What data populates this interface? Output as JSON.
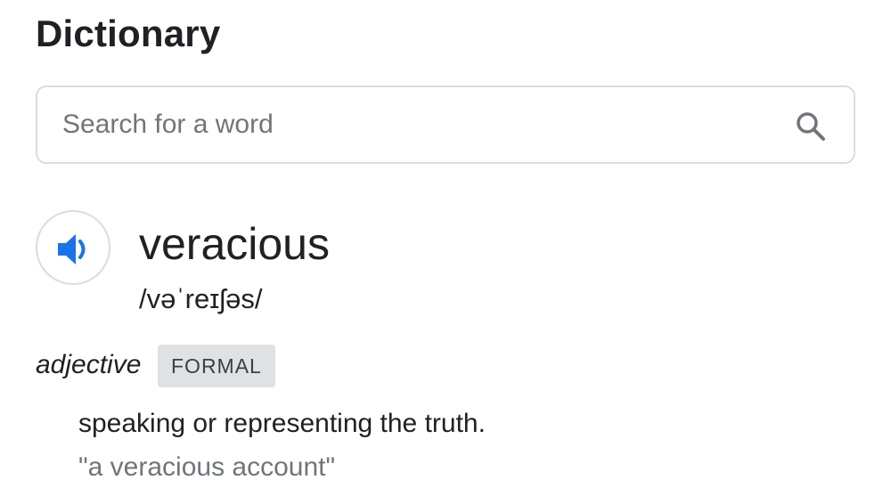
{
  "header": {
    "title": "Dictionary"
  },
  "search": {
    "placeholder": "Search for a word",
    "value": "",
    "icon": "search-icon"
  },
  "entry": {
    "audio_icon": "speaker-icon",
    "word": "veracious",
    "phonetic": "/vəˈreɪʃəs/",
    "part_of_speech": "adjective",
    "register_label": "FORMAL",
    "definition": "speaking or representing the truth.",
    "example": "\"a veracious account\""
  },
  "colors": {
    "accent": "#1a73e8",
    "border": "#dadce0",
    "badge_bg": "#dfe1e5",
    "text_primary": "#202124",
    "text_secondary": "#70757a"
  }
}
